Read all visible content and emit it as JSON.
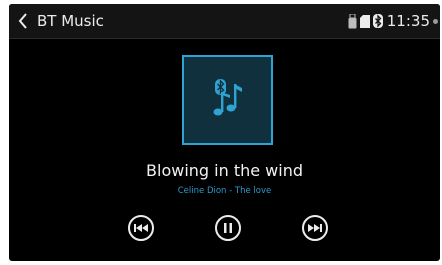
{
  "header": {
    "title": "BT Music",
    "time": "11:35",
    "icons": [
      "back-arrow-icon",
      "usb-icon",
      "sd-card-icon",
      "bluetooth-icon",
      "status-dot-icon"
    ]
  },
  "player": {
    "album_icon": "bluetooth-music-icon",
    "song_title": "Blowing in the wind",
    "artist_album": "Celine Dion - The love"
  },
  "controls": {
    "previous_icon": "skip-previous-icon",
    "play_pause_icon": "pause-icon",
    "next_icon": "skip-next-icon"
  },
  "colors": {
    "accent": "#2fa3d2",
    "artist_text": "#2c98cc",
    "album_bg": "#10303d",
    "screen_bg": "#000000",
    "statusbar_bg": "#141414"
  }
}
